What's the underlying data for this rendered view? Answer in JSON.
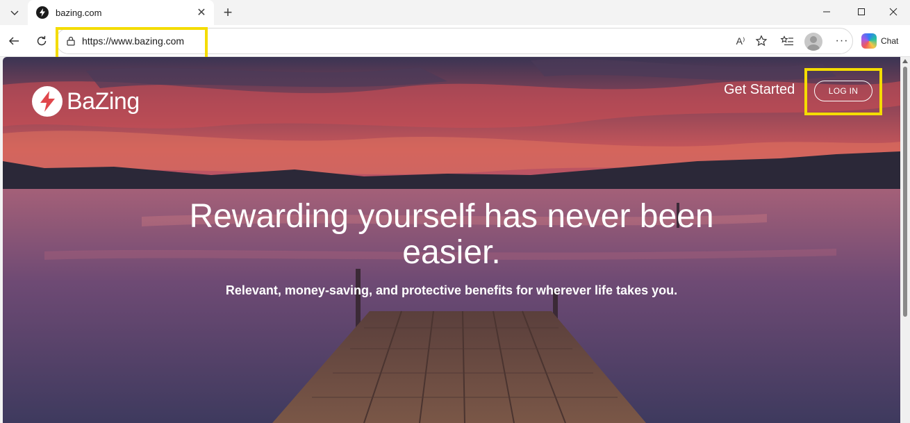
{
  "browser": {
    "tab": {
      "title": "bazing.com",
      "close_symbol": "✕"
    },
    "new_tab_symbol": "+",
    "window": {
      "minimize": "—",
      "maximize": "☐",
      "close": "✕"
    },
    "toolbar": {
      "url": "https://www.bazing.com",
      "read_aloud": "A⁾",
      "more": "···",
      "copilot_label": "Chat"
    },
    "highlight_color": "#f4dc00"
  },
  "page": {
    "brand_name": "BaZing",
    "nav": {
      "get_started": "Get Started",
      "login": "LOG IN"
    },
    "hero": {
      "title": "Rewarding yourself has never been easier.",
      "subtitle": "Relevant, money-saving, and protective benefits for wherever life takes you."
    }
  }
}
